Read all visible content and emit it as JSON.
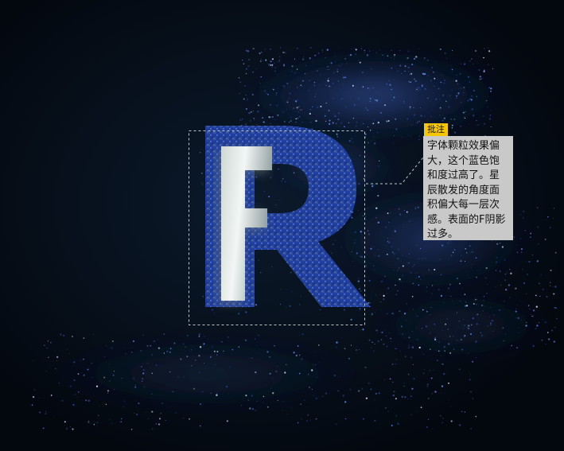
{
  "annotation": {
    "tag": "批注",
    "text": "字体颗粒效果偏大，这个蓝色饱和度过高了。星辰散发的角度面积偏大每一层次感。表面的F阴影过多。"
  },
  "artwork": {
    "letter_main": "R",
    "letter_overlay": "F",
    "background_color": "#03080f",
    "glitter_color": "#2a4fd0",
    "highlight_color": "#e8eeee"
  }
}
